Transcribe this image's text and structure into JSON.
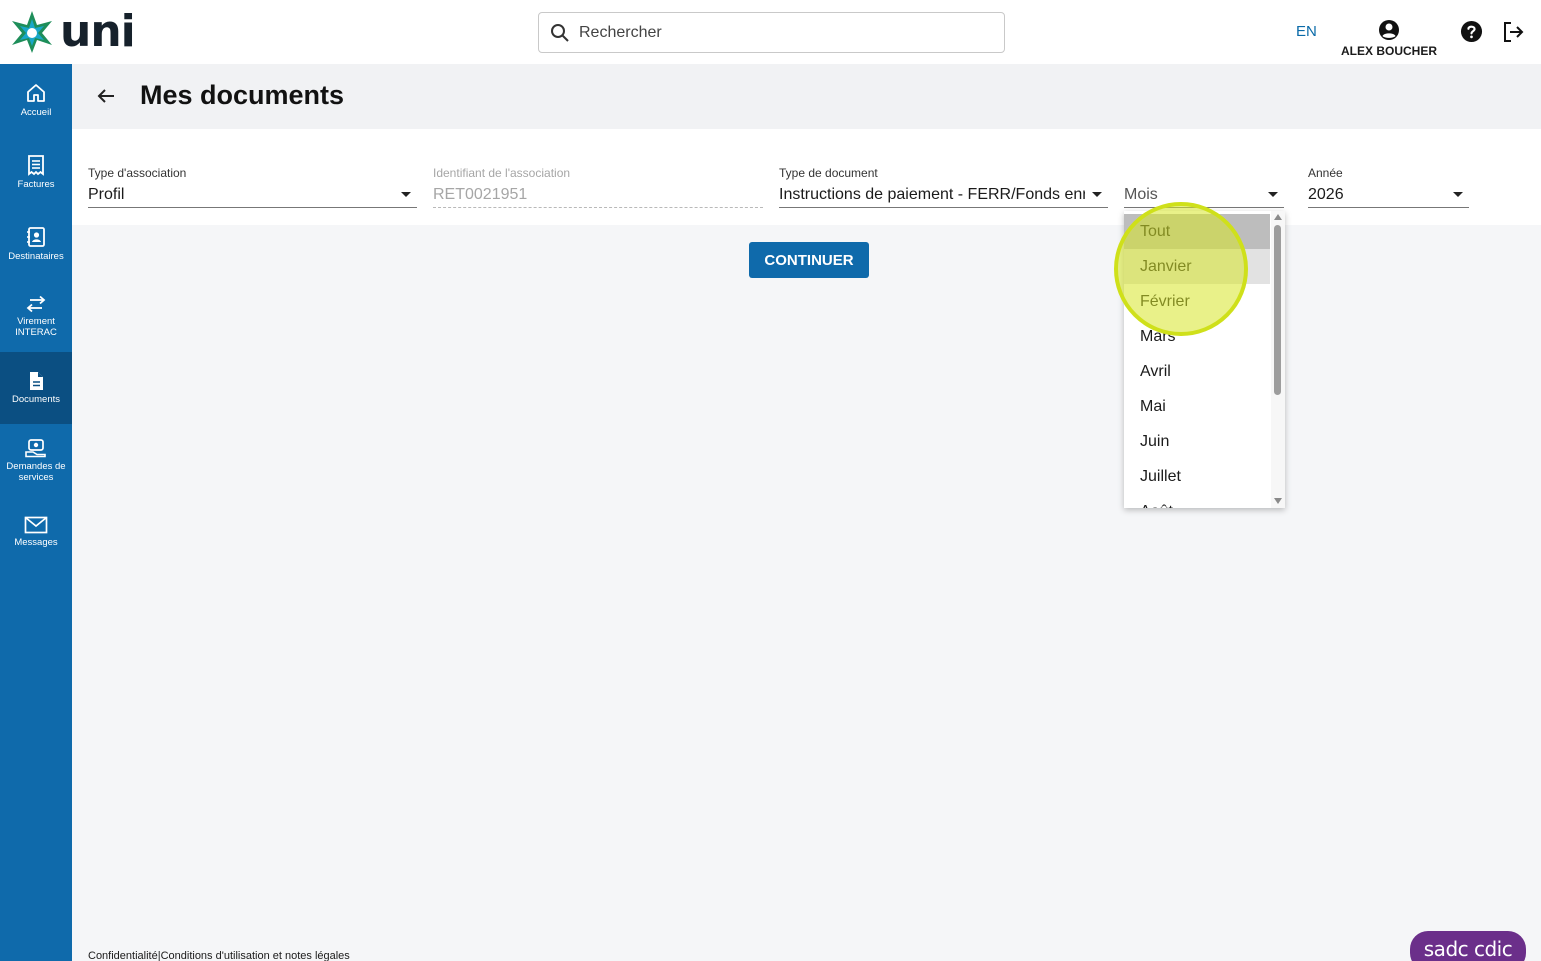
{
  "header": {
    "logo_text": "uni",
    "search_placeholder": "Rechercher",
    "lang": "EN",
    "user_name": "ALEX BOUCHER",
    "accent_color": "#0f6aab"
  },
  "sidebar": {
    "items": [
      {
        "label": "Accueil",
        "icon": "home-icon"
      },
      {
        "label": "Factures",
        "icon": "receipt-icon"
      },
      {
        "label": "Destinataires",
        "icon": "contacts-icon"
      },
      {
        "label": "Virement INTERAC",
        "icon": "transfer-arrows-icon"
      },
      {
        "label": "Documents",
        "icon": "document-icon",
        "active": true
      },
      {
        "label": "Demandes de services",
        "icon": "service-request-icon"
      },
      {
        "label": "Messages",
        "icon": "envelope-icon"
      }
    ]
  },
  "page": {
    "title": "Mes documents"
  },
  "form": {
    "association_type": {
      "label": "Type d'association",
      "value": "Profil"
    },
    "association_id": {
      "label": "Identifiant de l'association",
      "value": "RET0021951"
    },
    "document_type": {
      "label": "Type de document",
      "value": "Instructions de paiement - FERR/Fonds enregistrés"
    },
    "month": {
      "value": "Mois"
    },
    "year": {
      "label": "Année",
      "value": "2026"
    },
    "continue_label": "CONTINUER"
  },
  "month_dropdown": {
    "options": [
      "Tout",
      "Janvier",
      "Février",
      "Mars",
      "Avril",
      "Mai",
      "Juin",
      "Juillet",
      "Août"
    ],
    "selected": "Tout",
    "hovered": "Janvier"
  },
  "footer": {
    "privacy": "Confidentialité",
    "separator": "|",
    "terms": "Conditions d'utilisation et notes légales",
    "cdic_badge": "sadc cdic"
  }
}
